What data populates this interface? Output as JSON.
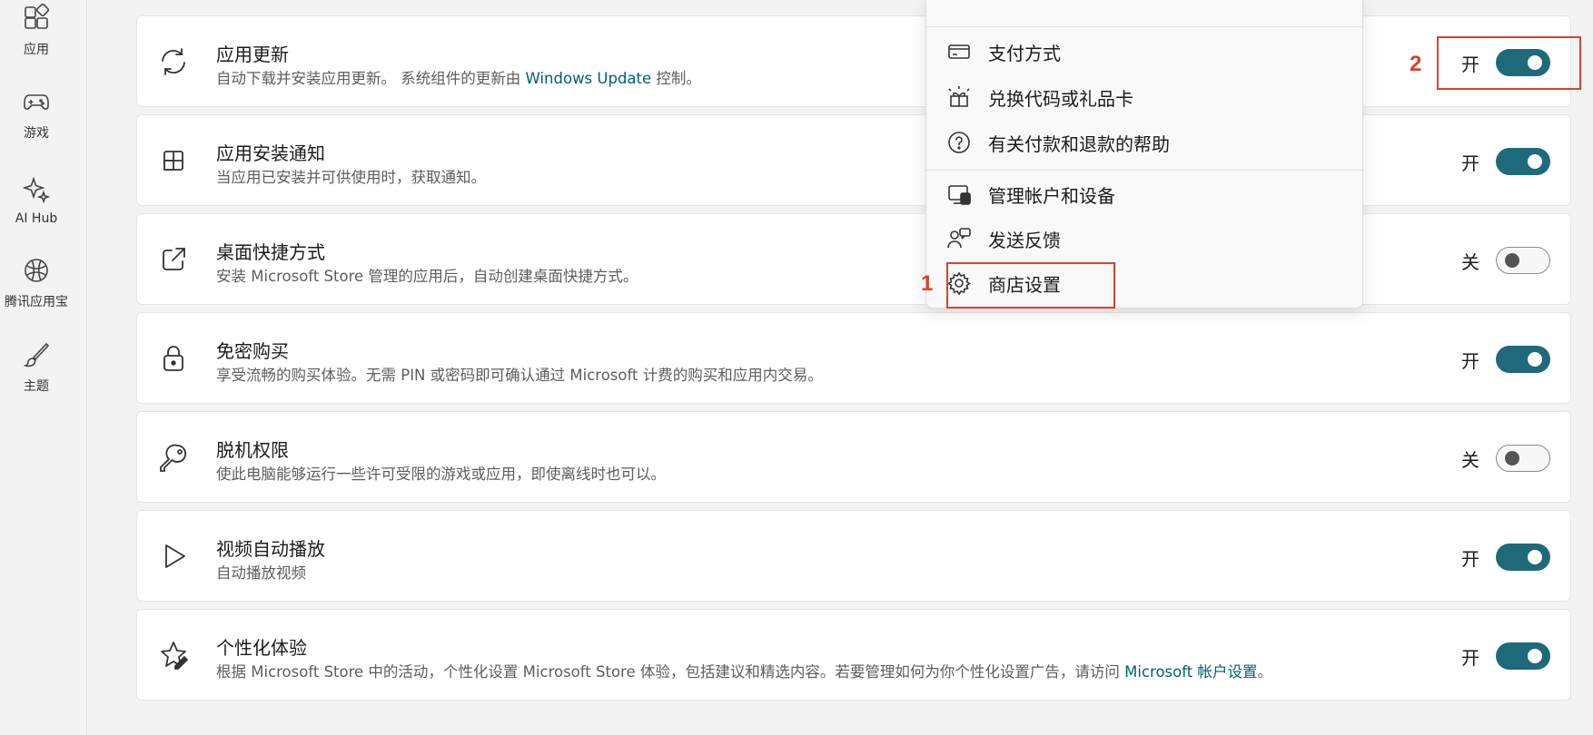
{
  "nav": [
    {
      "label": "应用",
      "icon": "apps-icon"
    },
    {
      "label": "游戏",
      "icon": "gamepad-icon"
    },
    {
      "label": "AI Hub",
      "icon": "sparkle-icon"
    },
    {
      "label": "腾讯应用宝",
      "icon": "tencent-app-icon"
    },
    {
      "label": "主题",
      "icon": "brush-icon"
    }
  ],
  "settings": [
    {
      "title": "应用更新",
      "desc_prefix": "自动下载并安装应用更新。 系统组件的更新由 ",
      "desc_link": "Windows Update",
      "desc_suffix": " 控制。",
      "state": "开",
      "on": true,
      "icon": "refresh-icon"
    },
    {
      "title": "应用安装通知",
      "desc": "当应用已安装并可供使用时，获取通知。",
      "state": "开",
      "on": true,
      "icon": "grid-notification-icon"
    },
    {
      "title": "桌面快捷方式",
      "desc": "安装 Microsoft Store 管理的应用后，自动创建桌面快捷方式。",
      "state": "关",
      "on": false,
      "icon": "external-link-icon"
    },
    {
      "title": "免密购买",
      "desc": "享受流畅的购买体验。无需 PIN 或密码即可确认通过 Microsoft 计费的购买和应用内交易。",
      "state": "开",
      "on": true,
      "icon": "lock-icon"
    },
    {
      "title": "脱机权限",
      "desc": "使此电脑能够运行一些许可受限的游戏或应用，即使离线时也可以。",
      "state": "关",
      "on": false,
      "icon": "key-icon"
    },
    {
      "title": "视频自动播放",
      "desc": "自动播放视频",
      "state": "开",
      "on": true,
      "icon": "play-icon"
    },
    {
      "title": "个性化体验",
      "desc_prefix": "根据 Microsoft Store 中的活动，个性化设置 Microsoft Store 体验，包括建议和精选内容。若要管理如何为你个性化设置广告，请访问 ",
      "desc_link": "Microsoft 帐户设置",
      "desc_suffix": "。",
      "state": "开",
      "on": true,
      "icon": "star-pen-icon"
    }
  ],
  "menu": {
    "items": [
      {
        "label": "支付方式",
        "icon": "card-icon"
      },
      {
        "label": "兑换代码或礼品卡",
        "icon": "gift-redeem-icon"
      },
      {
        "label": "有关付款和退款的帮助",
        "icon": "help-icon"
      },
      {
        "label": "管理帐户和设备",
        "icon": "devices-icon"
      },
      {
        "label": "发送反馈",
        "icon": "feedback-icon"
      },
      {
        "label": "商店设置",
        "icon": "gear-icon"
      }
    ]
  },
  "annotations": {
    "one": "1",
    "two": "2"
  },
  "colors": {
    "accent": "#1e6a7a",
    "annotation": "#d9412e",
    "link": "#005f73"
  }
}
